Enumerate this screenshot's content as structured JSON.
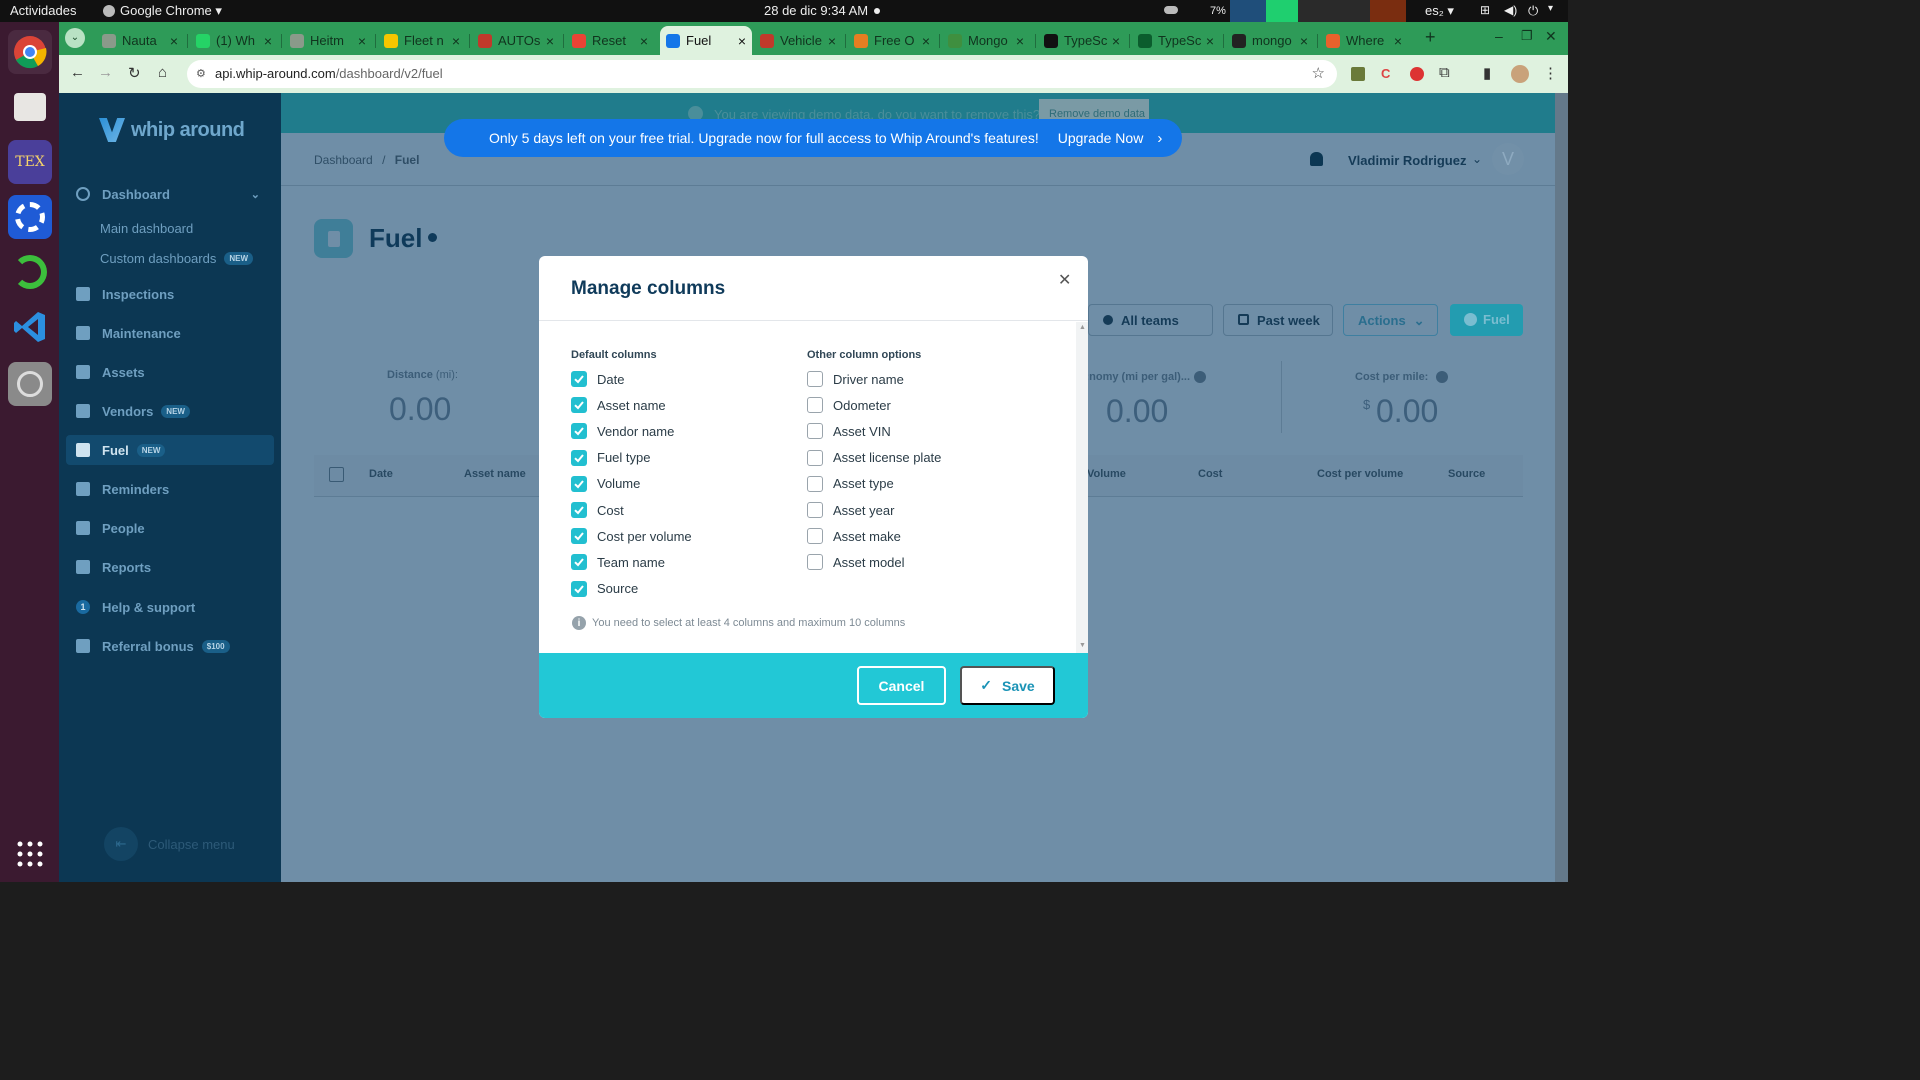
{
  "os": {
    "activities": "Actividades",
    "app_menu": "Google Chrome ▾",
    "clock": "28 de dic  9:34 AM",
    "battery": "7%",
    "keyboard_layout": "es₂ ▾"
  },
  "browser": {
    "tabs": [
      {
        "title": "Nauta",
        "color": "#8a9a8a"
      },
      {
        "title": "(1) Wh",
        "color": "#25d366"
      },
      {
        "title": "Heitm",
        "color": "#8a9a8a"
      },
      {
        "title": "Fleet n",
        "color": "#f7c600"
      },
      {
        "title": "AUTOs",
        "color": "#c0392b"
      },
      {
        "title": "Reset",
        "color": "#ea4335"
      },
      {
        "title": "Fuel",
        "color": "#1476e8",
        "active": true
      },
      {
        "title": "Vehicle",
        "color": "#c0392b"
      },
      {
        "title": "Free O",
        "color": "#e67e22"
      },
      {
        "title": "Mongo",
        "color": "#3f8f3f"
      },
      {
        "title": "TypeSc",
        "color": "#111111"
      },
      {
        "title": "TypeSc",
        "color": "#0b5d2d"
      },
      {
        "title": "mongo",
        "color": "#222222"
      },
      {
        "title": "Where",
        "color": "#e8622c"
      }
    ],
    "url_host": "api.whip-around.com",
    "url_path": "/dashboard/v2/fuel"
  },
  "app": {
    "logo": "whip around",
    "demo_notice": "You are viewing demo data, do you want to remove this?",
    "demo_button": "Remove demo data",
    "trial_text": "Only 5 days left on your free trial. Upgrade now for full access to Whip Around's features!",
    "trial_cta": "Upgrade Now",
    "breadcrumb": {
      "root": "Dashboard",
      "sep": "/",
      "current": "Fuel"
    },
    "user_name": "Vladimir Rodriguez",
    "user_initial": "V",
    "page_title": "Fuel",
    "filters": {
      "teams": "All teams",
      "period": "Past week",
      "actions": "Actions",
      "add": "Fuel"
    },
    "stats": [
      {
        "label": "Distance",
        "unit": "(mi):",
        "value": "0.00"
      },
      {
        "label": "...nomy (mi per gal):",
        "value": "0.00"
      },
      {
        "label": "Cost per mile:",
        "currency": "$",
        "value": "0.00"
      }
    ],
    "table_headers": [
      "Date",
      "Asset name",
      "Volume",
      "Cost",
      "Cost per volume",
      "Source"
    ]
  },
  "sidebar": {
    "dashboard_label": "Dashboard",
    "main_dashboard": "Main dashboard",
    "custom_dashboards": "Custom dashboards",
    "custom_badge": "NEW",
    "items": [
      {
        "label": "Inspections"
      },
      {
        "label": "Maintenance"
      },
      {
        "label": "Assets"
      },
      {
        "label": "Vendors",
        "badge": "NEW"
      },
      {
        "label": "Fuel",
        "badge": "NEW",
        "active": true
      },
      {
        "label": "Reminders"
      },
      {
        "label": "People"
      },
      {
        "label": "Reports"
      },
      {
        "label": "Help & support",
        "badge_num": "1"
      },
      {
        "label": "Referral bonus",
        "badge": "$100"
      }
    ],
    "collapse": "Collapse menu"
  },
  "modal": {
    "title": "Manage columns",
    "default_heading": "Default columns",
    "other_heading": "Other column options",
    "default_columns": [
      {
        "label": "Date",
        "checked": true
      },
      {
        "label": "Asset name",
        "checked": true
      },
      {
        "label": "Vendor name",
        "checked": true
      },
      {
        "label": "Fuel type",
        "checked": true
      },
      {
        "label": "Volume",
        "checked": true
      },
      {
        "label": "Cost",
        "checked": true
      },
      {
        "label": "Cost per volume",
        "checked": true
      },
      {
        "label": "Team name",
        "checked": true
      },
      {
        "label": "Source",
        "checked": true
      }
    ],
    "other_columns": [
      {
        "label": "Driver name",
        "checked": false
      },
      {
        "label": "Odometer",
        "checked": false
      },
      {
        "label": "Asset VIN",
        "checked": false
      },
      {
        "label": "Asset license plate",
        "checked": false
      },
      {
        "label": "Asset type",
        "checked": false
      },
      {
        "label": "Asset year",
        "checked": false
      },
      {
        "label": "Asset make",
        "checked": false
      },
      {
        "label": "Asset model",
        "checked": false
      }
    ],
    "hint": "You need to select at least 4 columns and maximum 10 columns",
    "cancel": "Cancel",
    "save": "Save"
  }
}
